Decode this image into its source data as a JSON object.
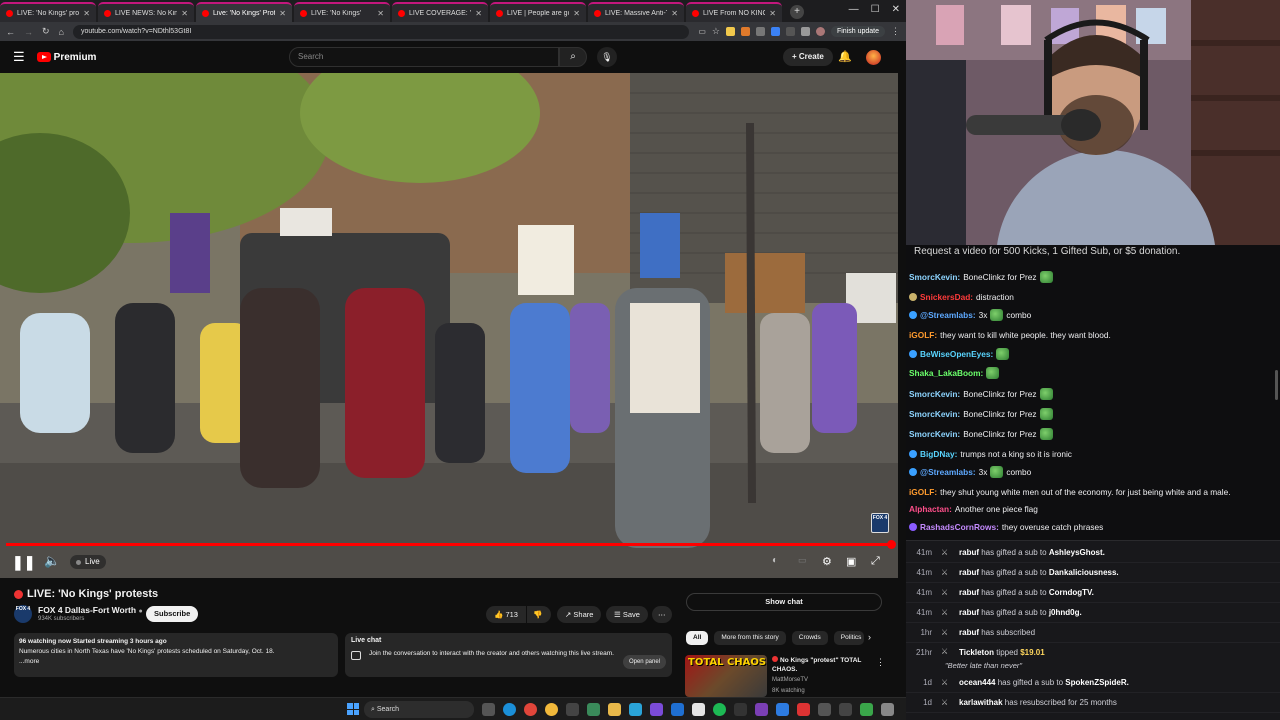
{
  "browser": {
    "tabs": [
      {
        "title": "LIVE: 'No Kings' protests",
        "active": false
      },
      {
        "title": "LIVE NEWS: No Kings p",
        "active": false
      },
      {
        "title": "Live: 'No Kings' Protests",
        "active": true
      },
      {
        "title": "LIVE: 'No Kings'",
        "active": false
      },
      {
        "title": "LIVE COVERAGE: 'No K",
        "active": false
      },
      {
        "title": "LIVE | People are go",
        "active": false
      },
      {
        "title": "LIVE: Massive Anti-Trum",
        "active": false
      },
      {
        "title": "LIVE From NO KINGS D",
        "active": false
      }
    ],
    "url": "youtube.com/watch?v=NDthl53Gt8I",
    "finish_update": "Finish update"
  },
  "youtube": {
    "logo_text": "Premium",
    "search_placeholder": "Search",
    "create_label": "Create",
    "video": {
      "live_label": "Live",
      "progress": 1.0,
      "channel_bug": "FOX 4"
    },
    "title": "LIVE: 'No Kings' protests",
    "channel": {
      "name": "FOX 4 Dallas-Fort Worth",
      "subscribers": "934K subscribers",
      "avatar_text": "FOX 4"
    },
    "subscribe_label": "Subscribe",
    "likes": "713",
    "share_label": "Share",
    "save_label": "Save",
    "description": {
      "stats_prefix": "96",
      "stats": " watching now  Started streaming 3 hours ago",
      "text": "Numerous cities in North Texas have 'No Kings' protests scheduled on Saturday, Oct. 18.",
      "more": "...more"
    },
    "live_chat": {
      "title": "Live chat",
      "text": "Join the conversation to interact with the creator and others watching this live stream.",
      "open_panel": "Open panel"
    },
    "show_chat": "Show chat",
    "chips": [
      "All",
      "More from this story",
      "Crowds",
      "Politics"
    ],
    "recommendation": {
      "thumb_text": "TOTAL CHAOS",
      "title": "No Kings \"protest\" TOTAL CHAOS.",
      "channel": "MattMorseTV",
      "watching": "8K watching"
    }
  },
  "taskbar": {
    "search_label": "Search"
  },
  "twitch": {
    "header": "Request a video for 500 Kicks, 1 Gifted Sub, or $5 donation.",
    "messages": [
      {
        "user": "SmorcKevin:",
        "color": "#8dd4ff",
        "badge": "",
        "text": "BoneClinkz for Prez",
        "emote": true
      },
      {
        "user": "SnickersDad:",
        "color": "#ff3b3b",
        "badge": "#c9b26b",
        "text": "distraction",
        "emote": false
      },
      {
        "user": "@Streamlabs:",
        "color": "#5ea9ff",
        "badge": "#3aa0ff",
        "text": "3x",
        "emote": true,
        "after": "combo"
      },
      {
        "user": "iGOLF:",
        "color": "#ff9b2e",
        "badge": "",
        "text": "they want to kill white people. they want blood.",
        "emote": false
      },
      {
        "user": "BeWiseOpenEyes:",
        "color": "#59d5ff",
        "badge": "#3aa0ff",
        "text": "",
        "emote": true
      },
      {
        "user": "Shaka_LakaBoom:",
        "color": "#6bff6b",
        "badge": "",
        "text": "",
        "emote": true
      },
      {
        "user": "SmorcKevin:",
        "color": "#8dd4ff",
        "badge": "",
        "text": "BoneClinkz for Prez",
        "emote": true
      },
      {
        "user": "SmorcKevin:",
        "color": "#8dd4ff",
        "badge": "",
        "text": "BoneClinkz for Prez",
        "emote": true
      },
      {
        "user": "SmorcKevin:",
        "color": "#8dd4ff",
        "badge": "",
        "text": "BoneClinkz for Prez",
        "emote": true
      },
      {
        "user": "BigDNay:",
        "color": "#59d5ff",
        "badge": "#3aa0ff",
        "text": "trumps not a king so it is ironic",
        "emote": false
      },
      {
        "user": "@Streamlabs:",
        "color": "#5ea9ff",
        "badge": "#3aa0ff",
        "text": "3x",
        "emote": true,
        "after": "combo"
      },
      {
        "user": "iGOLF:",
        "color": "#ff9b2e",
        "badge": "",
        "text": "they shut young white men out of the economy. for just being white and a male.",
        "emote": false
      },
      {
        "user": "Alphactan:",
        "color": "#ff4f8b",
        "badge": "",
        "text": "Another one piece flag",
        "emote": false
      },
      {
        "user": "RashadsCornRows:",
        "color": "#c58bff",
        "badge": "#8a5cff",
        "text": "they overuse catch phrases",
        "emote": false
      }
    ]
  },
  "feed": {
    "rows": [
      {
        "time": "41m",
        "user": "rabuf",
        "text": " has gifted a sub to ",
        "target": "AshleysGhost."
      },
      {
        "time": "41m",
        "user": "rabuf",
        "text": " has gifted a sub to ",
        "target": "Dankaliciousness."
      },
      {
        "time": "41m",
        "user": "rabuf",
        "text": " has gifted a sub to ",
        "target": "CorndogTV."
      },
      {
        "time": "41m",
        "user": "rabuf",
        "text": " has gifted a sub to ",
        "target": "j0hnd0g."
      },
      {
        "time": "1hr",
        "user": "rabuf",
        "text": " has subscribed",
        "target": ""
      },
      {
        "time": "21hr",
        "user": "Tickleton",
        "text": " tipped ",
        "target": "$19.01"
      },
      {
        "time": "1d",
        "user": "ocean444",
        "text": " has gifted a sub to ",
        "target": "SpokenZSpideR."
      },
      {
        "time": "1d",
        "user": "karlawithak",
        "text": " has resubscribed for 25 months",
        "target": ""
      }
    ],
    "tip_message": "\"Better late than never\""
  }
}
